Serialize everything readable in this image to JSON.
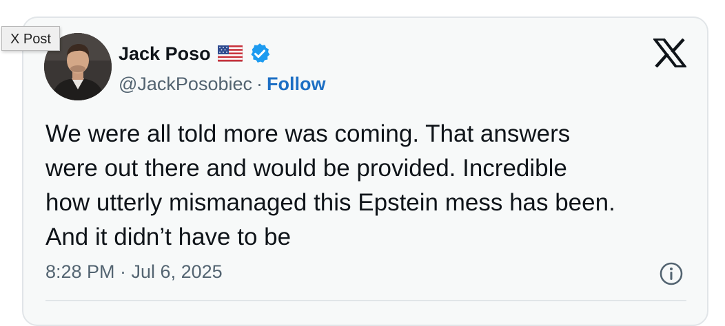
{
  "tooltip": {
    "label": "X Post"
  },
  "author": {
    "display_name": "Jack Poso",
    "flag_icon": "us-flag-icon",
    "verified_icon": "verified-badge-icon",
    "verified_color": "#1d9bf0",
    "handle": "@JackPosobiec",
    "separator": "·",
    "follow_label": "Follow",
    "follow_color": "#1d6fc4"
  },
  "brand": {
    "logo_icon": "x-logo-icon"
  },
  "tweet": {
    "text": "We were all told more was coming. That answers\nwere out there and would be provided. Incredible\nhow utterly mismanaged this Epstein mess has been.\nAnd it didn’t have to be",
    "timestamp": "8:28 PM · Jul 6, 2025",
    "info_icon": "info-icon"
  }
}
